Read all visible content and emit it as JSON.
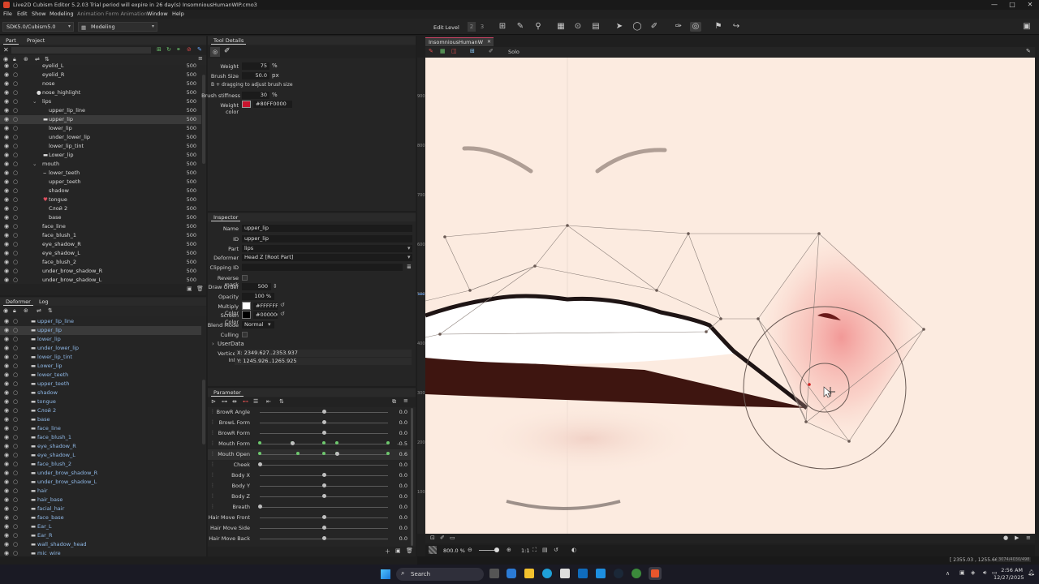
{
  "window": {
    "title": "Live2D Cubism Editor 5.2.03    Trial period will expire in 26 day(s)    InsomniousHumanWIP.cmo3",
    "min": "—",
    "max": "□",
    "close": "✕"
  },
  "menu": [
    "File",
    "Edit",
    "Show",
    "Modeling",
    "Animation",
    "Form Animation",
    "Window",
    "Help"
  ],
  "toolbar": {
    "sdk": "SDK5.0/Cubism5.0",
    "mode": "Modeling",
    "edit_level": "Edit Level",
    "level_icons": [
      "2",
      "3"
    ]
  },
  "part_panel": {
    "tabs": [
      "Part",
      "Project"
    ],
    "rows": [
      {
        "name": "eyelid_L",
        "num": "500",
        "indent": 52
      },
      {
        "name": "eyelid_R",
        "num": "500",
        "indent": 52
      },
      {
        "name": "nose",
        "num": "500",
        "indent": 52
      },
      {
        "name": "nose_highlight",
        "num": "500",
        "indent": 52,
        "icon": "●"
      },
      {
        "name": "lips",
        "num": "500",
        "indent": 52,
        "folder": true
      },
      {
        "name": "upper_lip_line",
        "num": "500",
        "indent": 60
      },
      {
        "name": "upper_lip",
        "num": "500",
        "indent": 60,
        "selected": true,
        "icon": "▬"
      },
      {
        "name": "lower_lip",
        "num": "500",
        "indent": 60
      },
      {
        "name": "under_lower_lip",
        "num": "500",
        "indent": 60
      },
      {
        "name": "lower_lip_tint",
        "num": "500",
        "indent": 60
      },
      {
        "name": "Lower_lip",
        "num": "500",
        "indent": 60,
        "icon": "▬"
      },
      {
        "name": "mouth",
        "num": "500",
        "indent": 52,
        "folder": true
      },
      {
        "name": "lower_teeth",
        "num": "500",
        "indent": 60,
        "icon": "⌣"
      },
      {
        "name": "upper_teeth",
        "num": "500",
        "indent": 60
      },
      {
        "name": "shadow",
        "num": "500",
        "indent": 60
      },
      {
        "name": "tongue",
        "num": "500",
        "indent": 60,
        "icon": "♥"
      },
      {
        "name": "Слой 2",
        "num": "500",
        "indent": 60
      },
      {
        "name": "base",
        "num": "500",
        "indent": 60
      },
      {
        "name": "face_line",
        "num": "500",
        "indent": 52
      },
      {
        "name": "face_blush_1",
        "num": "500",
        "indent": 52
      },
      {
        "name": "eye_shadow_R",
        "num": "500",
        "indent": 52
      },
      {
        "name": "eye_shadow_L",
        "num": "500",
        "indent": 52
      },
      {
        "name": "face_blush_2",
        "num": "500",
        "indent": 52
      },
      {
        "name": "under_brow_shadow_R",
        "num": "500",
        "indent": 52
      },
      {
        "name": "under_brow_shadow_L",
        "num": "500",
        "indent": 52
      }
    ]
  },
  "deformer_panel": {
    "tabs": [
      "Deformer",
      "Log"
    ],
    "rows": [
      {
        "name": "upper_lip_line"
      },
      {
        "name": "upper_lip",
        "selected": true
      },
      {
        "name": "lower_lip"
      },
      {
        "name": "under_lower_lip"
      },
      {
        "name": "lower_lip_tint"
      },
      {
        "name": "Lower_lip"
      },
      {
        "name": "lower_teeth"
      },
      {
        "name": "upper_teeth"
      },
      {
        "name": "shadow"
      },
      {
        "name": "tongue"
      },
      {
        "name": "Слой 2"
      },
      {
        "name": "base"
      },
      {
        "name": "face_line"
      },
      {
        "name": "face_blush_1"
      },
      {
        "name": "eye_shadow_R"
      },
      {
        "name": "eye_shadow_L"
      },
      {
        "name": "face_blush_2"
      },
      {
        "name": "under_brow_shadow_R"
      },
      {
        "name": "under_brow_shadow_L"
      },
      {
        "name": "hair"
      },
      {
        "name": "hair_base"
      },
      {
        "name": "facial_hair"
      },
      {
        "name": "face_base"
      },
      {
        "name": "Ear_L"
      },
      {
        "name": "Ear_R"
      },
      {
        "name": "wall_shadow_head"
      },
      {
        "name": "mic_wire"
      }
    ]
  },
  "tool_details": {
    "title": "Tool Details",
    "weight_label": "Weight",
    "weight": "75",
    "weight_unit": "%",
    "brush_label": "Brush Size",
    "brush": "50.0",
    "brush_unit": "px",
    "hint": "B + dragging to adjust brush size",
    "stiff_label": "Brush stiffness",
    "stiff": "30",
    "stiff_unit": "%",
    "wcolor_label": "Weight color",
    "wcolor": "#80FF0000",
    "swatch": "#c8142e"
  },
  "inspector": {
    "title": "Inspector",
    "fields": [
      {
        "label": "Name",
        "value": "upper_lip"
      },
      {
        "label": "ID",
        "value": "upper_lip"
      },
      {
        "label": "Part",
        "value": "lips"
      },
      {
        "label": "Deformer",
        "value": "Head Z  [Root Part]"
      },
      {
        "label": "Clipping ID",
        "value": ""
      }
    ],
    "reverse_mask": "Reverse mask",
    "draw_order_label": "Draw Order",
    "draw_order": "500",
    "opacity_label": "Opacity",
    "opacity": "100 %",
    "multiply_label": "Multiply Color",
    "multiply": "#FFFFFF",
    "screen_label": "Screen Color",
    "screen": "#000000",
    "blend_label": "Blend Mode",
    "blend": "Normal",
    "culling": "Culling",
    "userdata": "UserData",
    "vert_label": "Vertices Info",
    "vert_x": "X: 2349.627..2353.937",
    "vert_y": "Y: 1245.926..1265.925"
  },
  "parameter": {
    "title": "Parameter",
    "rows": [
      {
        "name": "BrowR Angle",
        "value": "0.0",
        "knob": 0.5
      },
      {
        "name": "BrowL Form",
        "value": "0.0",
        "knob": 0.5
      },
      {
        "name": "BrowR Form",
        "value": "0.0",
        "knob": 0.5
      },
      {
        "name": "Mouth Form",
        "value": "-0.5",
        "knob": 0.25,
        "keys": [
          0,
          0.25,
          0.5,
          0.6,
          1
        ]
      },
      {
        "name": "Mouth Open",
        "value": "0.6",
        "knob": 0.6,
        "keys": [
          0,
          0.3,
          0.5,
          0.6,
          1
        ],
        "highlight": true
      },
      {
        "name": "Cheek",
        "value": "0.0",
        "knob": 0
      },
      {
        "name": "Body X",
        "value": "0.0",
        "knob": 0.5
      },
      {
        "name": "Body Y",
        "value": "0.0",
        "knob": 0.5
      },
      {
        "name": "Body Z",
        "value": "0.0",
        "knob": 0.5
      },
      {
        "name": "Breath",
        "value": "0.0",
        "knob": 0
      },
      {
        "name": "Hair Move Front",
        "value": "0.0",
        "knob": 0.5
      },
      {
        "name": "Hair Move Side",
        "value": "0.0",
        "knob": 0.5
      },
      {
        "name": "Hair Move Back",
        "value": "0.0",
        "knob": 0.5
      }
    ]
  },
  "viewport": {
    "tab": "InsomniousHumanW",
    "solo": "Solo",
    "zoom": "800.0 %",
    "ratio": "1:1",
    "coords": "[ 2355.03 , 1255.66 ]",
    "res": "3074/4030/498",
    "ruler": [
      "900",
      "800",
      "700",
      "600",
      "500",
      "400",
      "300",
      "200",
      "100"
    ]
  },
  "taskbar": {
    "search": "Search",
    "time": "2:56 AM",
    "date": "12/27/2025"
  }
}
